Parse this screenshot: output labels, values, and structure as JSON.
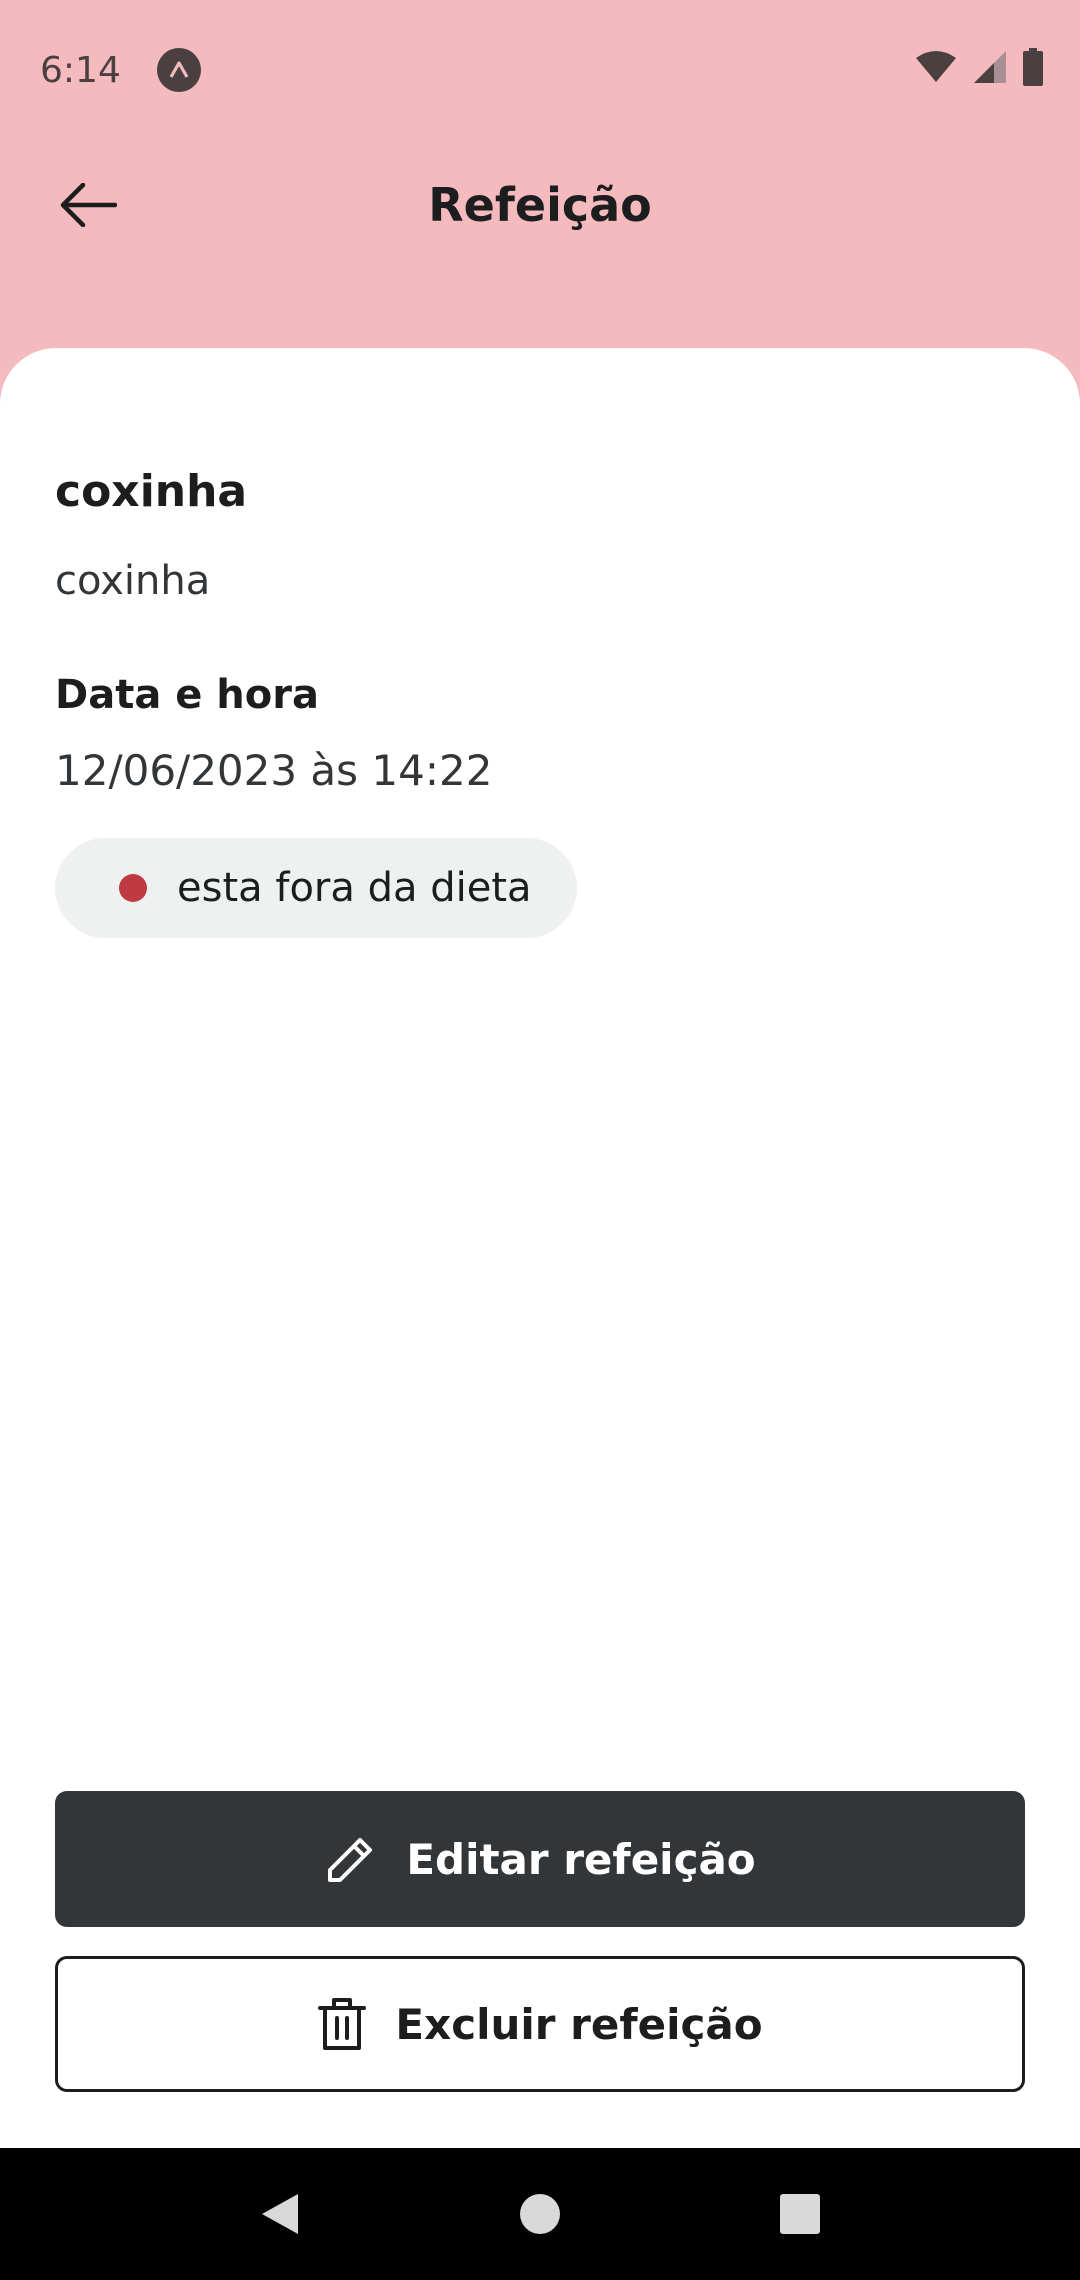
{
  "status_bar": {
    "time": "6:14"
  },
  "header": {
    "title": "Refeição",
    "back_icon": "arrow-left-icon"
  },
  "meal": {
    "name": "coxinha",
    "description": "coxinha",
    "datetime_label": "Data e hora",
    "datetime_value": "12/06/2023 às 14:22",
    "diet_status": "esta fora da dieta",
    "diet_status_color": "#BF3B44"
  },
  "actions": {
    "edit_label": "Editar refeição",
    "edit_icon": "pencil-icon",
    "delete_label": "Excluir refeição",
    "delete_icon": "trash-icon"
  },
  "colors": {
    "header_bg": "#F4BABD",
    "primary_button": "#333638",
    "badge_bg": "#EFF0F0"
  }
}
